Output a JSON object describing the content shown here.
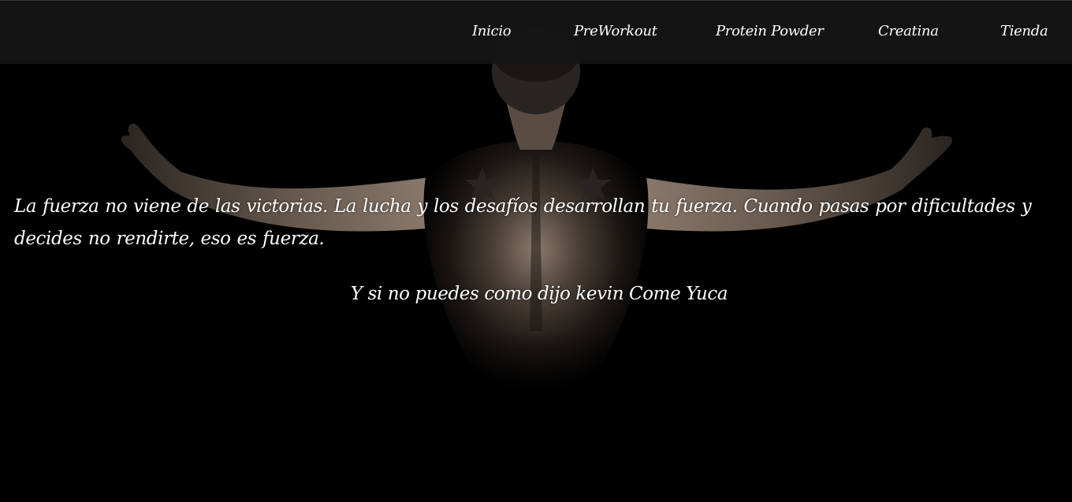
{
  "nav": {
    "items": [
      {
        "label": "Inicio"
      },
      {
        "label": "PreWorkout"
      },
      {
        "label": "Protein Powder"
      },
      {
        "label": "Creatina"
      },
      {
        "label": "Tienda"
      }
    ]
  },
  "hero": {
    "image": "muscular-back-arms-spread-photo",
    "quote": "La fuerza no viene de las victorias. La lucha y los desafíos desarrollan tu fuerza. Cuando pasas por dificultades y decides no rendirte, eso es fuerza.",
    "tagline": "Y si no puedes como dijo kevin Come Yuca"
  },
  "colors": {
    "background": "#000000",
    "navbar": "#161616",
    "text": "#ffffff"
  }
}
